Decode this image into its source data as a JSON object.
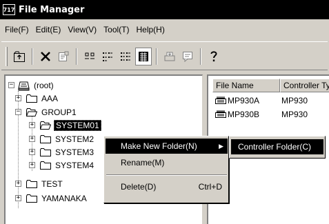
{
  "window": {
    "title": "File Manager",
    "icon_text": "717"
  },
  "menubar": [
    {
      "label": "File(F)"
    },
    {
      "label": "Edit(E)"
    },
    {
      "label": "View(V)"
    },
    {
      "label": "Tool(T)"
    },
    {
      "label": "Help(H)"
    }
  ],
  "toolbar": {
    "buttons": [
      {
        "icon": "up-folder-icon"
      },
      {
        "icon": "delete-icon"
      },
      {
        "icon": "properties-icon"
      },
      {
        "icon": "large-icons-icon"
      },
      {
        "icon": "small-icons-icon"
      },
      {
        "icon": "list-icon"
      },
      {
        "icon": "details-icon",
        "pressed": true
      },
      {
        "icon": "print-icon"
      },
      {
        "icon": "comment-icon"
      },
      {
        "icon": "help-icon"
      }
    ]
  },
  "tree": {
    "root": "(root)",
    "nodes": [
      {
        "label": "AAA",
        "expander": "+"
      },
      {
        "label": "GROUP1",
        "expander": "−"
      },
      {
        "label": "SYSTEM01",
        "expander": "+",
        "selected": true
      },
      {
        "label": "SYSTEM2",
        "expander": "+"
      },
      {
        "label": "SYSTEM3",
        "expander": "+"
      },
      {
        "label": "SYSTEM4",
        "expander": "+"
      },
      {
        "label": "TEST",
        "expander": "+"
      },
      {
        "label": "YAMANAKA",
        "expander": "+"
      }
    ]
  },
  "list": {
    "columns": [
      "File Name",
      "Controller Ty"
    ],
    "rows": [
      {
        "name": "MP930A",
        "controller": "MP930"
      },
      {
        "name": "MP930B",
        "controller": "MP930"
      }
    ]
  },
  "context_menu": {
    "items": [
      {
        "label": "Make New Folder(N)",
        "highlight": true,
        "submenu": true
      },
      {
        "label": "Rename(M)"
      },
      {
        "label": "Delete(D)",
        "shortcut": "Ctrl+D"
      }
    ],
    "submenu_item": "Controller Folder(C)"
  }
}
